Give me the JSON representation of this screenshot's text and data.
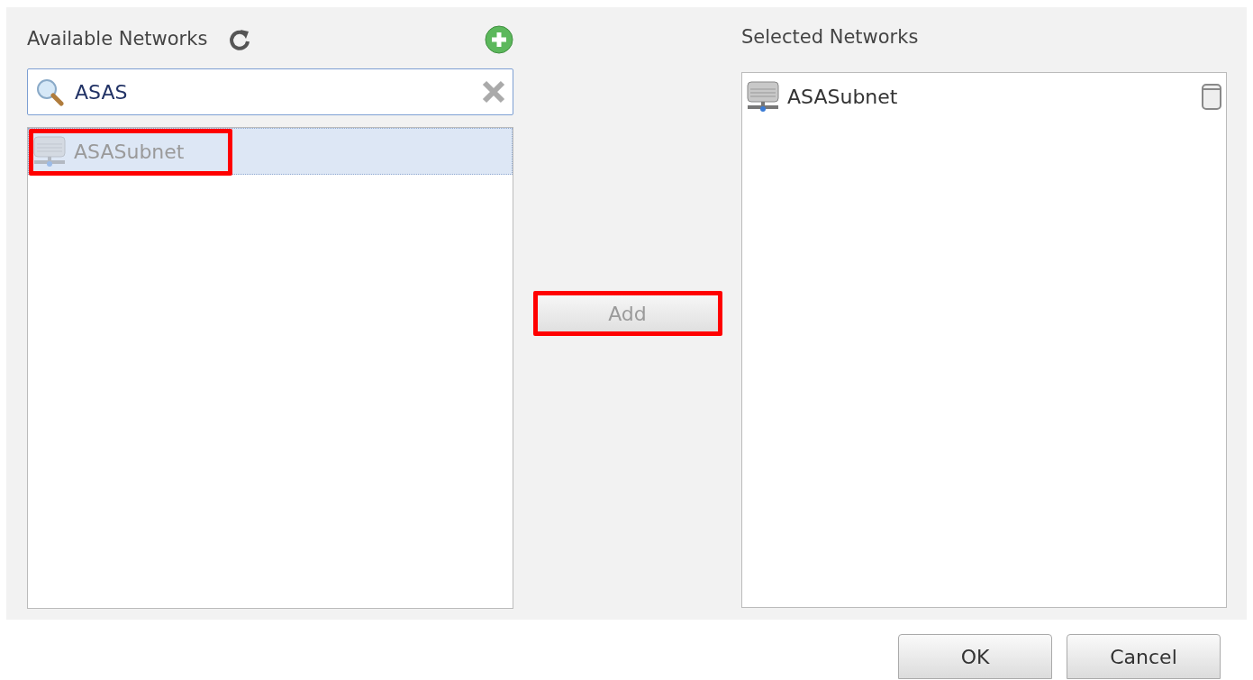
{
  "available": {
    "title": "Available Networks",
    "search": {
      "value": "ASAS"
    },
    "items": [
      {
        "name": "ASASubnet",
        "selected": true,
        "disabled": true,
        "highlighted": true
      }
    ]
  },
  "add_button": {
    "label": "Add",
    "disabled": true,
    "highlighted": true
  },
  "selected_networks": {
    "title": "Selected Networks",
    "items": [
      {
        "name": "ASASubnet",
        "selected": false,
        "disabled": false,
        "highlighted": false
      }
    ]
  },
  "buttons": [
    {
      "label": "OK"
    },
    {
      "label": "Cancel"
    }
  ]
}
